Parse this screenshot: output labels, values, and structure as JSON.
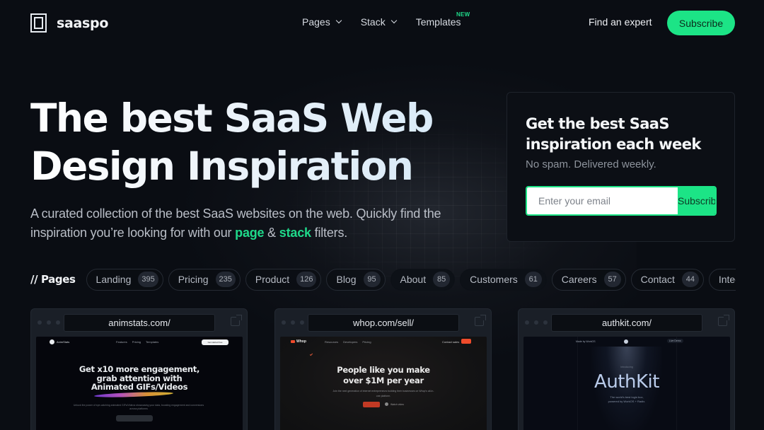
{
  "nav": {
    "logo_text": "saaspo",
    "links": [
      {
        "label": "Pages",
        "has_dropdown": true
      },
      {
        "label": "Stack",
        "has_dropdown": true
      },
      {
        "label": "Templates",
        "badge": "NEW"
      }
    ],
    "find_expert": "Find an expert",
    "subscribe": "Subscribe"
  },
  "hero": {
    "title_line1": "The best SaaS Web",
    "title_line2": "Design Inspiration",
    "subtitle_part1": "A curated collection of the best SaaS websites on the web. Quickly find the inspiration you’re looking for with our ",
    "subtitle_link1": "page",
    "subtitle_amp": " & ",
    "subtitle_link2": "stack",
    "subtitle_part2": " filters."
  },
  "newsletter": {
    "title": "Get the best SaaS inspiration each week",
    "subtitle": "No spam. Delivered weekly.",
    "email_placeholder": "Enter your email",
    "email_value": "",
    "button": "Subscribe"
  },
  "filters": {
    "label": "// Pages",
    "chips": [
      {
        "label": "Landing",
        "count": "395"
      },
      {
        "label": "Pricing",
        "count": "235"
      },
      {
        "label": "Product",
        "count": "126"
      },
      {
        "label": "Blog",
        "count": "95"
      },
      {
        "label": "About",
        "count": "85"
      },
      {
        "label": "Customers",
        "count": "61"
      },
      {
        "label": "Careers",
        "count": "57"
      },
      {
        "label": "Contact",
        "count": "44"
      },
      {
        "label": "Integrati",
        "count": ""
      }
    ]
  },
  "cards": [
    {
      "url": "animstats.com/",
      "preview": {
        "brand": "AnimStats",
        "links": [
          "Features",
          "Pricing",
          "Templates"
        ],
        "cta": "Get started free",
        "headline_1": "Get x10 more engagement,",
        "headline_2": "grab attention with",
        "headline_3": "Animated GIFs/Videos",
        "body": "Unlock the power of eye-catching animated GIFs/Videos showcasing your data, boosting engagement and conversions across platforms"
      }
    },
    {
      "url": "whop.com/sell/",
      "preview": {
        "brand": "Whop",
        "links": [
          "Resources",
          "Developers",
          "Pricing"
        ],
        "contact": "Contact sales",
        "headline_1": "People like you make",
        "headline_2": "over $1M per year",
        "body": "Join the next generation of internet entrepreneurs building their businesses on Whop's all-in-one platform.",
        "demo": "Watch video"
      }
    },
    {
      "url": "authkit.com/",
      "preview": {
        "left_link": "Made by WorkOS",
        "right_link": "Live Demo",
        "tag": "Introducing",
        "headline": "AuthKit",
        "body_1": "The world's best login box,",
        "body_2": "powered by WorkOS + Radix."
      }
    }
  ],
  "colors": {
    "accent": "#1ce486",
    "background": "#0a0d13"
  }
}
